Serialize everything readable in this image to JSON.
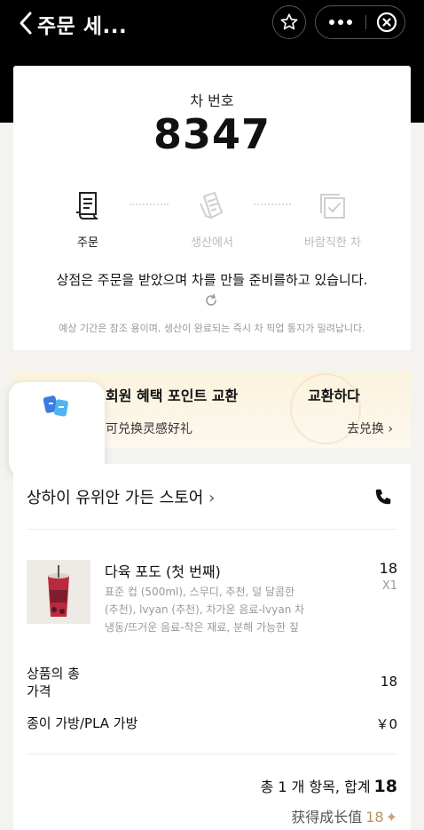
{
  "nav": {
    "title": "주문 세...",
    "icons": [
      "chevron-left-icon",
      "star-icon",
      "more-icon",
      "close-circle-icon"
    ]
  },
  "pickup": {
    "label": "차 번호",
    "number": "8347"
  },
  "steps": [
    {
      "label": "주문",
      "icon": "receipt-icon",
      "active": true
    },
    {
      "label": "생산에서",
      "icon": "cup-icon",
      "active": false
    },
    {
      "label": "바람직한 차",
      "icon": "check-box-icon",
      "active": false
    }
  ],
  "status_message": "상점은 주문을 받았으며 차를 만들 준비를하고 있습니다.",
  "status_note": "예상 기간은 참조 용이며, 생산이 완료되는 즉시 차 픽업 통지가 밀려납니다.",
  "banner": {
    "title": "회원 혜택 포인트 교환",
    "title_right": "교환하다",
    "subtitle": "可兑换灵感好礼",
    "link": "去兑换",
    "deco_char": "喜"
  },
  "store": {
    "name": "상하이 유위안 가든 스토어"
  },
  "item": {
    "name": "다육 포도 (첫 번째)",
    "price": "18",
    "qty": "X1",
    "spec_lines": [
      "표준 컵 (500ml), 스무디, 추천, 덜 달콤한",
      "(추천), lvyan (추천), 차가운 음료-lvyan 차",
      "냉동/뜨거운 음료-작은 재료, 분해 가능한 짚"
    ]
  },
  "summary": {
    "subtotal_label_1": "상품의 총",
    "subtotal_label_2": "가격",
    "subtotal_value": "18",
    "bag_label": "종이 가방/PLA 가방",
    "bag_value": "￥0",
    "total_text": "총 1 개 항목, 합계",
    "total_value": "18",
    "growth_label": "获得成长值",
    "growth_value": "18"
  },
  "colors": {
    "topbar": "#000000",
    "background": "#f4f3ef",
    "accent_gold": "#c9a46b"
  }
}
